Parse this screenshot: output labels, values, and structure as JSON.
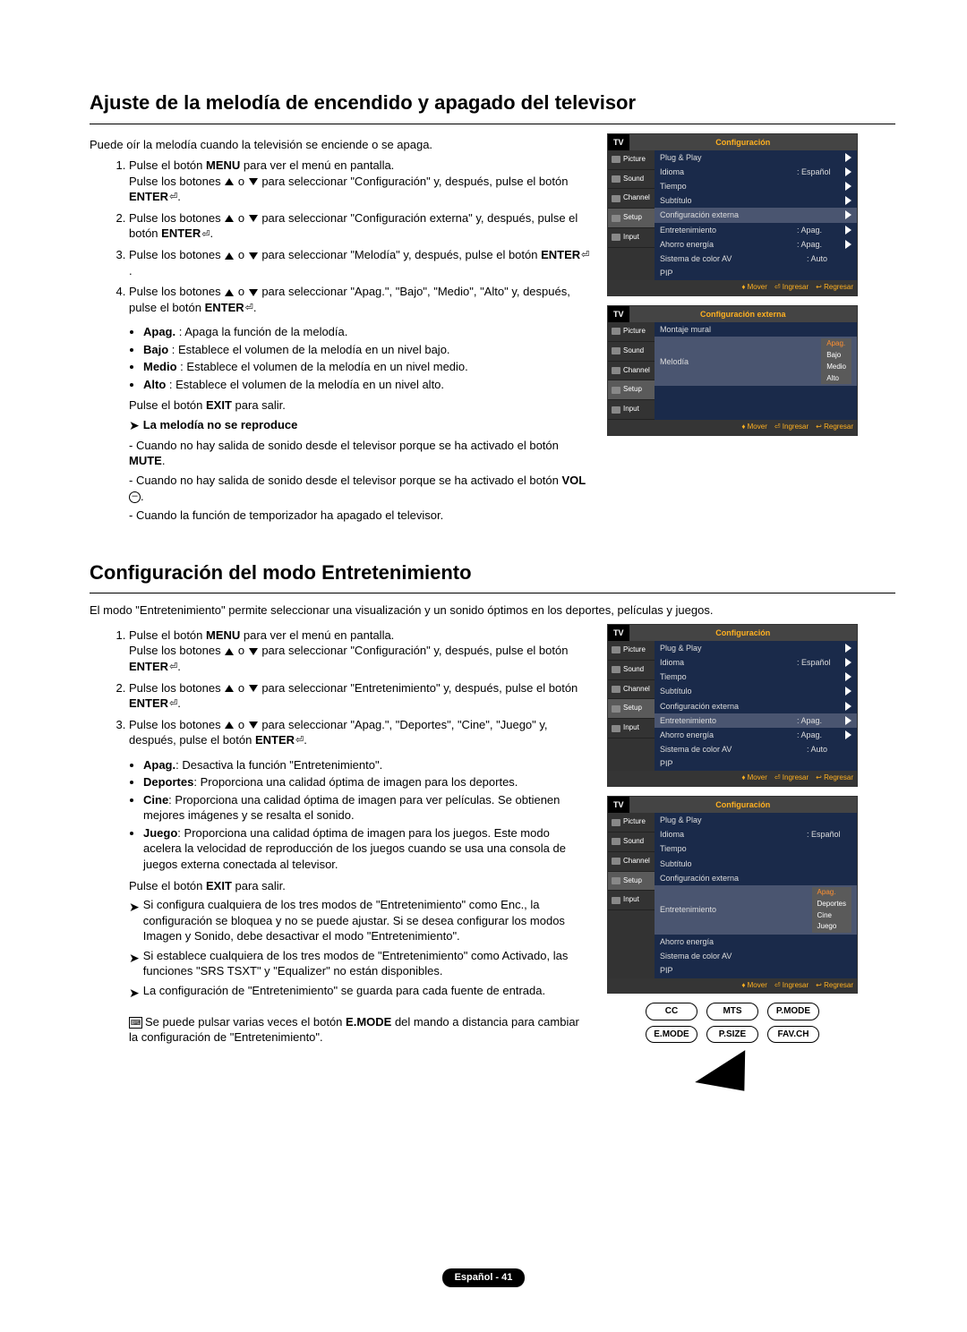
{
  "sec1": {
    "title": "Ajuste de la melodía de encendido y apagado del televisor",
    "intro": "Puede oír la melodía cuando la televisión se enciende o se apaga.",
    "s1a": "Pulse el botón ",
    "s1b": "MENU",
    "s1c": " para ver el menú en pantalla.",
    "s1d": "Pulse los botones ",
    "s1e": " o ",
    "s1f": " para seleccionar \"Configuración\" y, después, pulse el botón ",
    "s1g": "ENTER",
    "s2a": "Pulse los botones ",
    "s2b": " o ",
    "s2c": " para seleccionar \"Configuración externa\" y, después, pulse el botón ",
    "s2d": "ENTER",
    "s3a": "Pulse los botones ",
    "s3b": " o ",
    "s3c": " para seleccionar \"Melodía\" y, después, pulse el botón ",
    "s3d": "ENTER",
    "s4a": "Pulse los botones ",
    "s4b": " o ",
    "s4c": " para seleccionar \"Apag.\", \"Bajo\", \"Medio\", \"Alto\" y, después, pulse el botón ",
    "s4d": "ENTER",
    "b1a": "Apag.",
    "b1b": " : Apaga la función de la melodía.",
    "b2a": "Bajo",
    "b2b": " : Establece el volumen de la melodía en un nivel bajo.",
    "b3a": "Medio",
    "b3b": " : Establece el volumen de la melodía en un nivel medio.",
    "b4a": "Alto",
    "b4b": " : Establece el volumen de la melodía en un nivel alto.",
    "exit_a": "Pulse el botón ",
    "exit_b": "EXIT",
    "exit_c": " para salir.",
    "noplay": "La melodía no se reproduce",
    "np1a": "- Cuando no hay salida de sonido desde el televisor porque se ha activado el botón ",
    "np1b": "MUTE",
    "np1c": ".",
    "np2a": "- Cuando no hay salida de sonido desde el televisor porque se ha activado el botón ",
    "np2b": "VOL",
    "np2c": ".",
    "np3": "- Cuando la función de temporizador ha apagado el televisor."
  },
  "sec2": {
    "title": "Configuración del modo Entretenimiento",
    "intro": "El modo \"Entretenimiento\" permite seleccionar una visualización y un sonido óptimos en los deportes, películas y juegos.",
    "s1a": "Pulse el botón ",
    "s1b": "MENU",
    "s1c": " para ver el menú en pantalla.",
    "s1d": "Pulse los botones ",
    "s1e": " o ",
    "s1f": " para seleccionar \"Configuración\" y, después, pulse el botón ",
    "s1g": "ENTER",
    "s2a": "Pulse los botones ",
    "s2b": " o ",
    "s2c": " para seleccionar \"Entretenimiento\" y, después, pulse el botón ",
    "s2d": "ENTER",
    "s3a": "Pulse los botones ",
    "s3b": " o ",
    "s3c": " para seleccionar \"Apag.\", \"Deportes\", \"Cine\", \"Juego\" y, después, pulse el botón ",
    "s3d": "ENTER",
    "b1a": "Apag.",
    "b1b": ": Desactiva la función \"Entretenimiento\".",
    "b2a": "Deportes",
    "b2b": ": Proporciona una calidad óptima de imagen para los deportes.",
    "b3a": "Cine",
    "b3b": ": Proporciona una calidad óptima de imagen para ver películas. Se obtienen mejores imágenes y se resalta el sonido.",
    "b4a": "Juego",
    "b4b": ": Proporciona una calidad óptima de imagen para los juegos. Este modo acelera la velocidad de reproducción de los juegos cuando se usa una consola de juegos externa conectada al televisor.",
    "exit_a": "Pulse el botón ",
    "exit_b": "EXIT",
    "exit_c": " para salir.",
    "n1": "Si configura cualquiera de los tres modos de \"Entretenimiento\" como Enc., la configuración se bloquea y no se puede ajustar. Si se desea configurar los modos Imagen y Sonido, debe desactivar el modo \"Entretenimiento\".",
    "n2": "Si establece cualquiera de los tres modos de \"Entretenimiento\" como Activado, las funciones \"SRS TSXT\" y \"Equalizer\" no están disponibles.",
    "n3": "La configuración de \"Entretenimiento\" se guarda para cada fuente de entrada.",
    "kb_a": "Se puede pulsar varias veces el botón ",
    "kb_b": "E.MODE",
    "kb_c": " del mando a distancia para cambiar la configuración de \"Entretenimiento\"."
  },
  "osd": {
    "tv": "TV",
    "conf": "Configuración",
    "confext": "Configuración externa",
    "picture": "Picture",
    "sound": "Sound",
    "channel": "Channel",
    "setup": "Setup",
    "input": "Input",
    "pp": "Plug & Play",
    "idioma": "Idioma",
    "esp": ": Español",
    "tiempo": "Tiempo",
    "subt": "Subtítulo",
    "cfgext": "Configuración externa",
    "entret": "Entretenimiento",
    "apag": ": Apag.",
    "ahorro": "Ahorro energía",
    "siscol": "Sistema de color AV",
    "auto": ": Auto",
    "pip": "PIP",
    "montaje": "Montaje mural",
    "melodia": "Melodía",
    "o_apag": "Apag.",
    "o_bajo": "Bajo",
    "o_medio": "Medio",
    "o_alto": "Alto",
    "o_dep": "Deportes",
    "o_cine": "Cine",
    "o_juego": "Juego",
    "mover": "Mover",
    "ingresar": "Ingresar",
    "regresar": "Regresar"
  },
  "remote": {
    "cc": "CC",
    "mts": "MTS",
    "pmode": "P.MODE",
    "emode": "E.MODE",
    "psize": "P.SIZE",
    "favch": "FAV.CH"
  },
  "footer": "Español - 41"
}
